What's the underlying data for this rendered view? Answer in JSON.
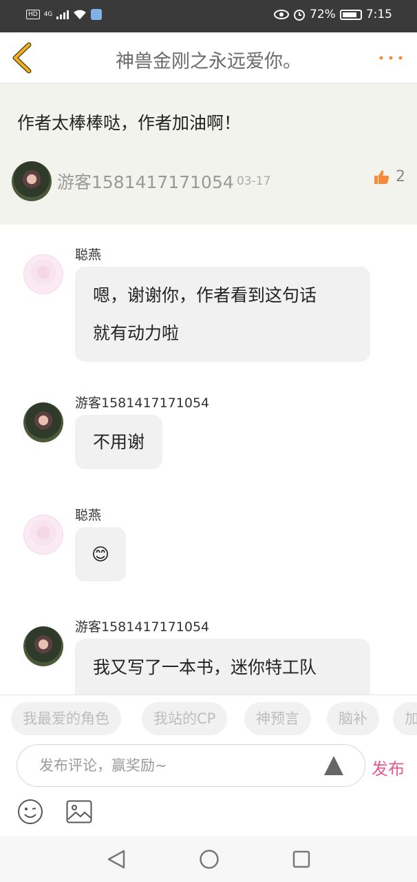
{
  "status_bar": {
    "hd": "HD",
    "network": "4G",
    "battery": "72%",
    "time": "7:15"
  },
  "header": {
    "title": "神兽金刚之永远爱你。"
  },
  "main_comment": {
    "text": "作者太棒棒哒，作者加油啊！",
    "user": "游客1581417171054",
    "date": "03-17",
    "likes": "2"
  },
  "replies": [
    {
      "name": "聪燕",
      "lines": [
        "嗯，谢谢你，作者看到这句话",
        "就有动力啦"
      ],
      "avatar": "pink"
    },
    {
      "name": "游客1581417171054",
      "lines": [
        "不用谢"
      ],
      "avatar": "dark"
    },
    {
      "name": "聪燕",
      "lines": [
        "😊"
      ],
      "avatar": "pink"
    },
    {
      "name": "游客1581417171054",
      "lines": [
        "我又写了一本书，迷你特工队"
      ],
      "avatar": "dark"
    }
  ],
  "tags": [
    "我最爱的角色",
    "我站的CP",
    "神预言",
    "脑补",
    "加"
  ],
  "composer": {
    "placeholder": "发布评论，赢奖励~",
    "publish_label": "发布"
  },
  "colors": {
    "accent": "#e45c8a",
    "like": "#f7893b",
    "back_arrow": "#f0b020",
    "more": "#f7893b"
  },
  "icons": [
    "back-arrow-icon",
    "more-icon",
    "thumbs-up-icon",
    "send-arrow-icon",
    "emoji-icon",
    "image-icon",
    "nav-back-icon",
    "nav-home-icon",
    "nav-recent-icon"
  ]
}
